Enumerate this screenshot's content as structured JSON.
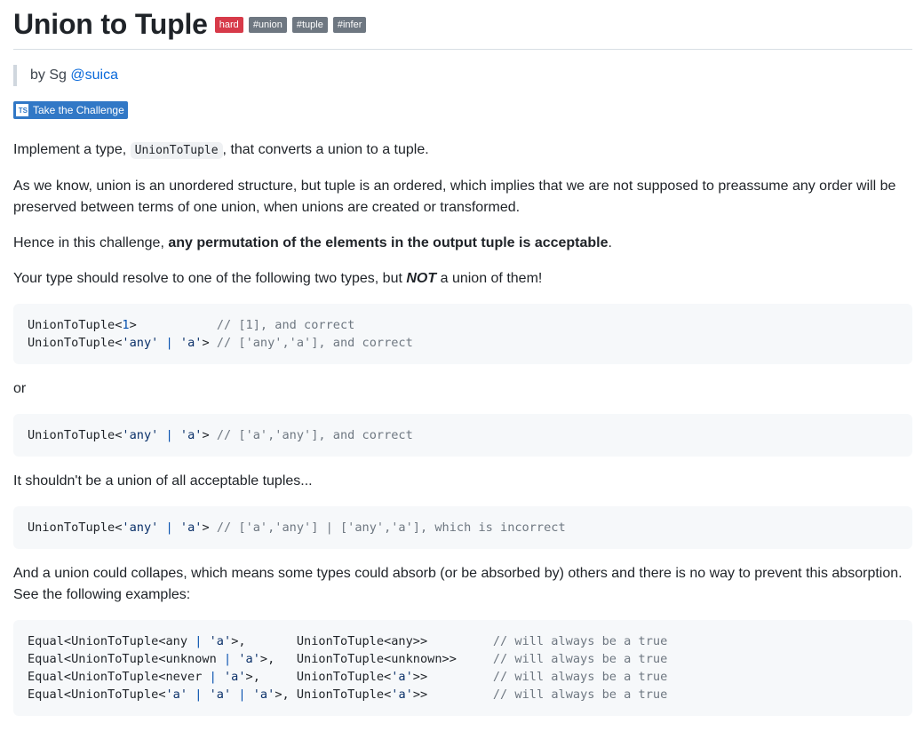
{
  "title": "Union to Tuple",
  "badges": {
    "difficulty": "hard",
    "tags": [
      "#union",
      "#tuple",
      "#infer"
    ]
  },
  "author": {
    "prefix": "by Sg",
    "handle": "@suica"
  },
  "challenge_button": {
    "icon": "TS",
    "label": "Take the Challenge"
  },
  "content": {
    "p1_before": "Implement a type,",
    "p1_code": "UnionToTuple",
    "p1_after": ", that converts a union to a tuple.",
    "p2": "As we know, union is an unordered structure, but tuple is an ordered, which implies that we are not supposed to preassume any order will be preserved between terms of one union, when unions are created or transformed.",
    "p3_before": "Hence in this challenge,",
    "p3_bold": "any permutation of the elements in the output tuple is acceptable",
    "p3_after": ".",
    "p4_before": "Your type should resolve to one of the following two types, but",
    "p4_emph": "NOT",
    "p4_after": "a union of them!",
    "or": "or",
    "p5": "It shouldn't be a union of all acceptable tuples...",
    "p6": "And a union could collapes, which means some types could absorb (or be absorbed by) others and there is no way to prevent this absorption. See the following examples:"
  },
  "code1": {
    "l1_fn": "UnionToTuple<",
    "l1_num": "1",
    "l1_close": ">",
    "l1_pad": "           ",
    "l1_comment": "// [1], and correct",
    "l2_fn": "UnionToTuple<",
    "l2_s1": "'any'",
    "l2_pipe": " | ",
    "l2_s2": "'a'",
    "l2_close": "> ",
    "l2_comment": "// ['any','a'], and correct"
  },
  "code2": {
    "fn": "UnionToTuple<",
    "s1": "'any'",
    "pipe": " | ",
    "s2": "'a'",
    "close": "> ",
    "comment": "// ['a','any'], and correct"
  },
  "code3": {
    "fn": "UnionToTuple<",
    "s1": "'any'",
    "pipe": " | ",
    "s2": "'a'",
    "close": "> ",
    "comment": "// ['a','any'] | ['any','a'], which is incorrect"
  },
  "code4": {
    "r1_a": "Equal<UnionToTuple<any",
    "r1_pipe": " | ",
    "r1_s": "'a'",
    "r1_b": ">,       UnionToTuple<any>>         ",
    "r1_c": "// will always be a true",
    "r2_a": "Equal<UnionToTuple<unknown",
    "r2_pipe": " | ",
    "r2_s": "'a'",
    "r2_b": ">,   UnionToTuple<unknown>>     ",
    "r2_c": "// will always be a true",
    "r3_a": "Equal<UnionToTuple<never",
    "r3_pipe": " | ",
    "r3_s": "'a'",
    "r3_b": ">,     UnionToTuple<",
    "r3_s2": "'a'",
    "r3_b2": ">>         ",
    "r3_c": "// will always be a true",
    "r4_a": "Equal<UnionToTuple<",
    "r4_s1": "'a'",
    "r4_pipe1": " | ",
    "r4_s2": "'a'",
    "r4_pipe2": " | ",
    "r4_s3": "'a'",
    "r4_b": ">, UnionToTuple<",
    "r4_s4": "'a'",
    "r4_b2": ">>         ",
    "r4_c": "// will always be a true"
  },
  "colors": {
    "hard_badge": "#d73a49",
    "tag_badge": "#6e7781",
    "link": "#0969da",
    "ts_button": "#3178c6",
    "code_bg": "#f6f8fa"
  }
}
